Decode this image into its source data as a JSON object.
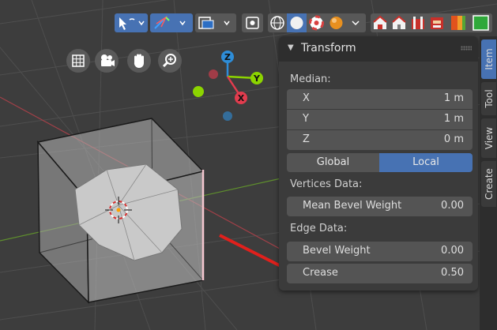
{
  "header": {
    "buttons": [
      {
        "icon": "select-mode-icon"
      },
      {
        "icon": "transform-gizmo-icon"
      },
      {
        "icon": "overlays-icon"
      },
      {
        "icon": "xray-toggle-icon"
      },
      {
        "icon": "shading-wireframe-icon"
      },
      {
        "icon": "shading-solid-icon"
      },
      {
        "icon": "shading-material-icon"
      },
      {
        "icon": "shading-rendered-icon"
      },
      {
        "icon": "house-icon"
      },
      {
        "icon": "house-icon"
      },
      {
        "icon": "house-icon"
      },
      {
        "icon": "house-icon"
      },
      {
        "icon": "color-swatch-icon"
      },
      {
        "icon": "color-swatch-icon"
      }
    ]
  },
  "navigation": {
    "buttons": [
      "grid-view-icon",
      "camera-icon",
      "hand-pan-icon",
      "zoom-icon"
    ]
  },
  "gizmo": {
    "axes": {
      "x": "X",
      "y": "Y",
      "z": "Z"
    },
    "colors": {
      "x": "#e23c4e",
      "y": "#8cd400",
      "z": "#2e8dd8"
    }
  },
  "panel": {
    "title": "Transform",
    "median_label": "Median:",
    "median": [
      {
        "label": "X",
        "value": "1 m"
      },
      {
        "label": "Y",
        "value": "1 m"
      },
      {
        "label": "Z",
        "value": "0 m"
      }
    ],
    "toggle": {
      "global": "Global",
      "local": "Local",
      "active": "local"
    },
    "vertices_label": "Vertices Data:",
    "vertices": [
      {
        "label": "Mean Bevel Weight",
        "value": "0.00"
      }
    ],
    "edge_label": "Edge Data:",
    "edge": [
      {
        "label": "Bevel Weight",
        "value": "0.00"
      },
      {
        "label": "Crease",
        "value": "0.50"
      }
    ]
  },
  "tabs": [
    {
      "label": "Item",
      "active": true
    },
    {
      "label": "Tool",
      "active": false
    },
    {
      "label": "View",
      "active": false
    },
    {
      "label": "Create",
      "active": false
    }
  ],
  "colors": {
    "accent": "#4772b3",
    "annotation_arrow": "#e0201c",
    "selected_edge": "#f4c6cf"
  }
}
